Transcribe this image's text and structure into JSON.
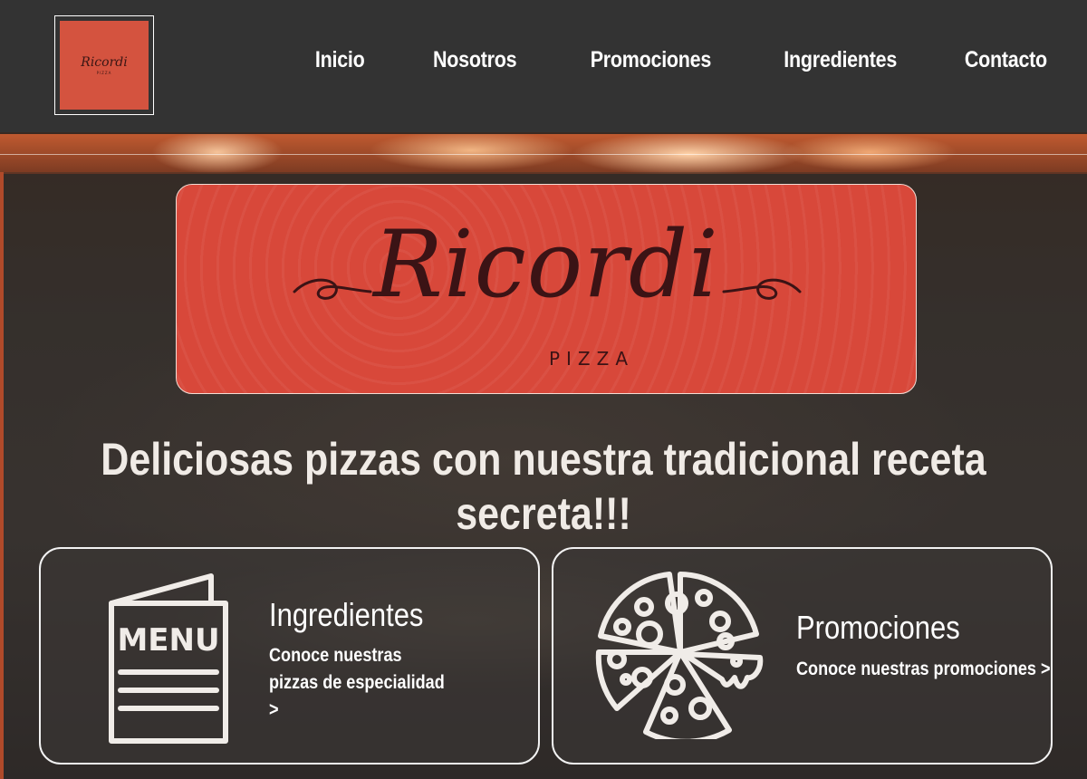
{
  "header": {
    "logo": {
      "name": "Ricordi",
      "sub": "PIZZA"
    },
    "nav": [
      "Inicio",
      "Nosotros",
      "Promociones",
      "Ingredientes",
      "Contacto"
    ]
  },
  "hero": {
    "banner": {
      "name": "Ricordi",
      "sub": "PIZZA"
    },
    "headline": "Deliciosas pizzas con nuestra tradicional receta secreta!!!"
  },
  "cards": [
    {
      "title": "Ingredientes",
      "link": "Conoce nuestras pizzas de especialidad >",
      "icon": "menu-icon",
      "icon_text": "MENU"
    },
    {
      "title": "Promociones",
      "link": "Conoce nuestras promociones >",
      "icon": "pizza-icon"
    }
  ],
  "colors": {
    "topbar": "#333333",
    "brand_red": "#d8483a",
    "brand_dark": "#3b1315",
    "text_light": "#ffffff"
  }
}
